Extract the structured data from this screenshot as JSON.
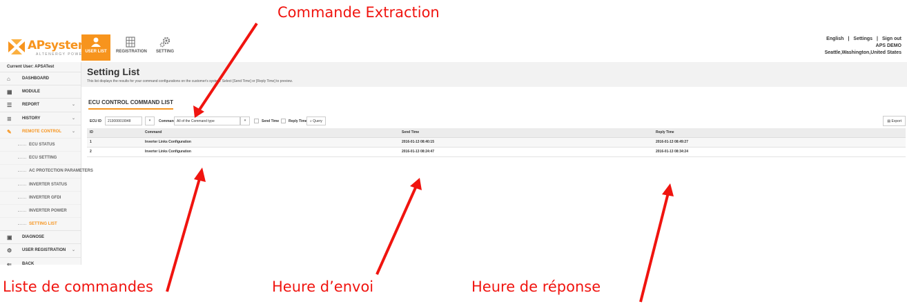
{
  "annotations": {
    "top": "Commande Extraction",
    "command_list": "Liste de commandes",
    "send_time": "Heure d’envoi",
    "reply_time": "Heure de réponse"
  },
  "colors": {
    "accent": "#f7941d",
    "annotation": "#f0140f"
  },
  "header": {
    "logo_text": "APsystems",
    "logo_sub": "ALTENERGY POWER",
    "tabs": [
      {
        "label": "USER LIST",
        "icon": "users-icon",
        "active": true
      },
      {
        "label": "REGISTRATION",
        "icon": "grid-icon",
        "active": false
      },
      {
        "label": "SETTING",
        "icon": "gear-icon",
        "active": false
      }
    ],
    "links": {
      "language": "English",
      "settings": "Settings",
      "signout": "Sign out"
    },
    "user_name": "APS DEMO",
    "user_location": "Seattle,Washington,United States"
  },
  "sidebar": {
    "current_user": "Current User: APSATest",
    "items": [
      {
        "label": "DASHBOARD",
        "icon": "home-icon"
      },
      {
        "label": "MODULE",
        "icon": "module-grid-icon"
      },
      {
        "label": "REPORT",
        "icon": "list-icon",
        "chevron": "⌄"
      },
      {
        "label": "HISTORY",
        "icon": "database-icon",
        "chevron": "⌄"
      },
      {
        "label": "REMOTE CONTROL",
        "icon": "wrench-icon",
        "chevron": "⌄",
        "active": true
      }
    ],
    "sub_items": [
      {
        "label": "ECU STATUS"
      },
      {
        "label": "ECU SETTING"
      },
      {
        "label": "AC PROTECTION PARAMETERS"
      },
      {
        "label": "INVERTER STATUS"
      },
      {
        "label": "INVERTER GFDI"
      },
      {
        "label": "INVERTER POWER"
      },
      {
        "label": "SETTING LIST",
        "active": true
      }
    ],
    "items_after": [
      {
        "label": "DIAGNOSE",
        "icon": "camera-icon"
      },
      {
        "label": "USER REGISTRATION",
        "icon": "gears-icon",
        "chevron": "⌄"
      },
      {
        "label": "BACK",
        "icon": "back-icon"
      }
    ]
  },
  "main": {
    "title": "Setting List",
    "description": "This list displays the results for your command configurations on the customer's system. Select [Send Time] or [Reply Time] to preview.",
    "section_title": "ECU CONTROL COMMAND LIST",
    "filters": {
      "ecu_label": "ECU ID",
      "ecu_value": "213000019948",
      "command_label": "Command",
      "command_value": "All of the Command type",
      "send_time_label": "Send Time",
      "reply_time_label": "Reply Time",
      "query_label": "Query",
      "export_label": "Export"
    },
    "table": {
      "headers": [
        "ID",
        "Command",
        "Send Time",
        "Reply Time"
      ],
      "rows": [
        [
          "1",
          "Inverter Links Configuration",
          "2016-01-13 08:40:15",
          "2016-01-13 08:49:27"
        ],
        [
          "2",
          "Inverter Links Configuration",
          "2016-01-13 08:24:47",
          "2016-01-13 08:34:24"
        ]
      ]
    }
  }
}
